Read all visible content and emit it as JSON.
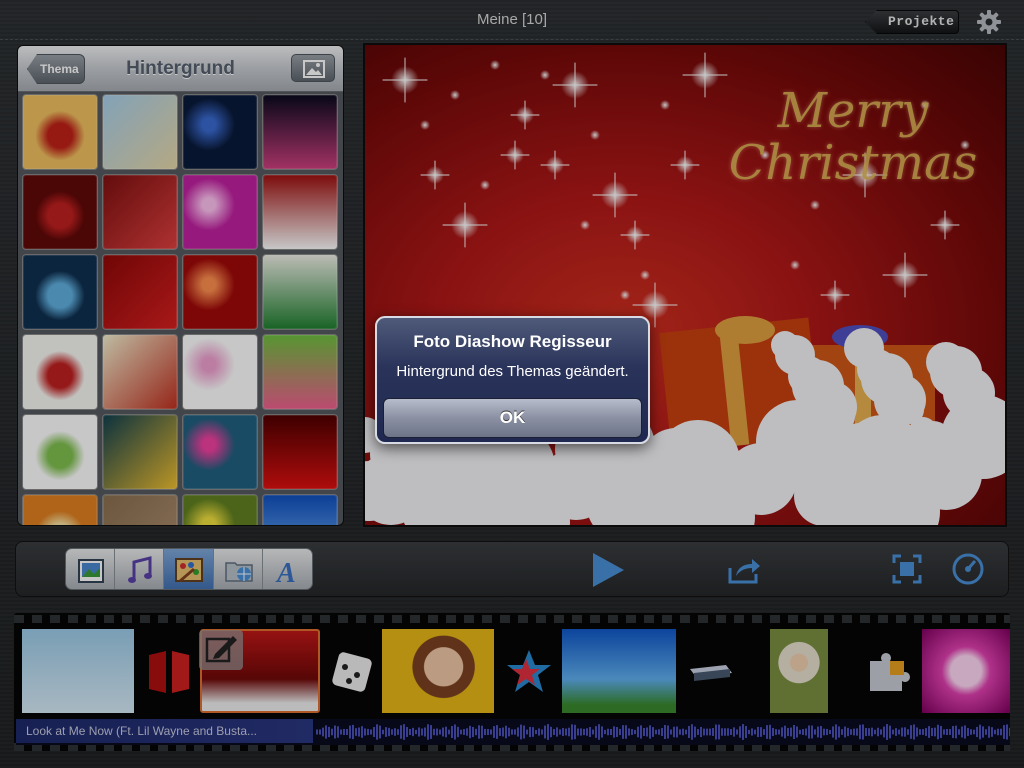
{
  "header": {
    "project_title": "Meine  [10]",
    "projects_button": "Projekte",
    "settings_icon": "gear-icon"
  },
  "left_panel": {
    "back_button": "Thema",
    "title": "Hintergrund",
    "photo_button_icon": "photo-icon",
    "thumbnails": [
      {
        "name": "floral-gold-heart-bg",
        "colors": [
          "#f0c060",
          "#c02018"
        ]
      },
      {
        "name": "clouds-sky-bg",
        "colors": [
          "#a8d0ec",
          "#e8d8a8"
        ]
      },
      {
        "name": "fireworks-blue-bg",
        "colors": [
          "#0a1a3a",
          "#3a6ad0"
        ]
      },
      {
        "name": "fireworks-pink-bg",
        "colors": [
          "#0a0a20",
          "#d04080"
        ]
      },
      {
        "name": "party-crowd-red-bg",
        "colors": [
          "#600808",
          "#c02020"
        ]
      },
      {
        "name": "hearts-red-bg",
        "colors": [
          "#801010",
          "#e04040"
        ]
      },
      {
        "name": "heart-pink-bg",
        "colors": [
          "#c020a0",
          "#ffc0f0"
        ]
      },
      {
        "name": "merry-christmas-bg",
        "colors": [
          "#a01010",
          "#ffffff"
        ]
      },
      {
        "name": "dancers-blue-bg",
        "colors": [
          "#103050",
          "#60b0e0"
        ]
      },
      {
        "name": "red-ornaments-bg",
        "colors": [
          "#900808",
          "#d82020"
        ]
      },
      {
        "name": "red-burst-bg",
        "colors": [
          "#a00808",
          "#ff9050"
        ]
      },
      {
        "name": "christmas-branch-bg",
        "colors": [
          "#f0f0e8",
          "#208030"
        ]
      },
      {
        "name": "holly-ornaments-bg",
        "colors": [
          "#f8f8f4",
          "#c02020"
        ]
      },
      {
        "name": "christmas-trees-bg",
        "colors": [
          "#f4f0d0",
          "#c03020"
        ]
      },
      {
        "name": "happy-birthday-candles-bg",
        "colors": [
          "#ffffff",
          "#f0a0d0"
        ]
      },
      {
        "name": "happy-birthday-green-bg",
        "colors": [
          "#70c040",
          "#f06090"
        ]
      },
      {
        "name": "leaf-frame-bg",
        "colors": [
          "#ffffff",
          "#80c050"
        ]
      },
      {
        "name": "happy-birthday-balloons-bg",
        "colors": [
          "#104050",
          "#f0c030"
        ]
      },
      {
        "name": "happy-birthday-blue-bg",
        "colors": [
          "#206080",
          "#f040a0"
        ]
      },
      {
        "name": "red-curtain-bg",
        "colors": [
          "#500000",
          "#e01010"
        ]
      },
      {
        "name": "orange-frame-bg",
        "colors": [
          "#e08020",
          "#f8e0a0"
        ]
      },
      {
        "name": "beige-plain-bg",
        "colors": [
          "#8a7050",
          "#b09070"
        ]
      },
      {
        "name": "bokeh-yellow-bg",
        "colors": [
          "#608020",
          "#f0e040"
        ]
      },
      {
        "name": "blue-sky-bg",
        "colors": [
          "#1050c0",
          "#80c0ff"
        ]
      }
    ]
  },
  "preview": {
    "greeting": "Merry Christmas"
  },
  "alert": {
    "title": "Foto Diashow Regisseur",
    "message": "Hintergrund des Themas geändert.",
    "ok_label": "OK"
  },
  "toolbar": {
    "segments": [
      {
        "name": "photos-tab",
        "icon": "photos-icon",
        "active": false
      },
      {
        "name": "music-tab",
        "icon": "music-icon",
        "active": false
      },
      {
        "name": "theme-tab",
        "icon": "palette-icon",
        "active": true
      },
      {
        "name": "export-tab",
        "icon": "folder-globe-icon",
        "active": false
      },
      {
        "name": "text-tab",
        "icon": "text-icon",
        "active": false
      }
    ],
    "play_icon": "play-icon",
    "share_icon": "share-icon",
    "fit_icon": "fit-screen-icon",
    "speed_icon": "speedometer-icon"
  },
  "timeline": {
    "audio_label": "Look at Me Now (Ft. Lil Wayne and Busta..."
  },
  "colors": {
    "accent_blue": "#4a90d8",
    "alert_bg": "#2a335a",
    "active_segment": "#3f6fb0",
    "audio_wave": "#4a50b8"
  }
}
